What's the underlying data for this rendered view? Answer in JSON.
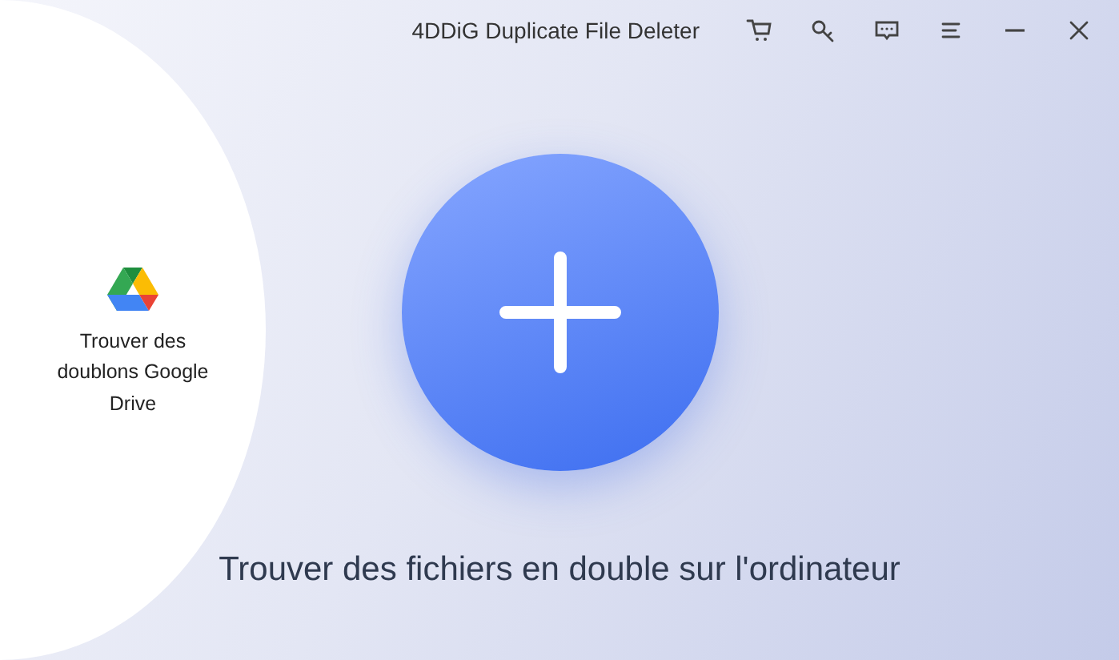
{
  "window": {
    "title": "4DDiG Duplicate File Deleter"
  },
  "side_option": {
    "label": "Trouver des doublons Google Drive"
  },
  "main_action": {
    "label": "Trouver des fichiers en double sur l'ordinateur"
  }
}
